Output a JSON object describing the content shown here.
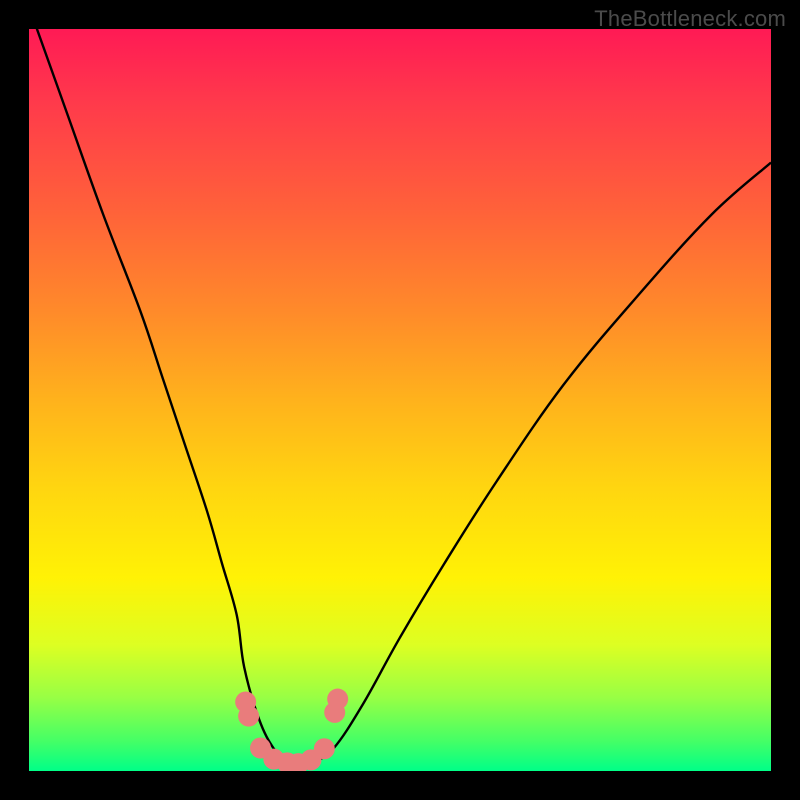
{
  "watermark": {
    "text": "TheBottleneck.com"
  },
  "chart_data": {
    "type": "line",
    "title": "",
    "xlabel": "",
    "ylabel": "",
    "xlim": [
      0,
      100
    ],
    "ylim": [
      0,
      100
    ],
    "series": [
      {
        "name": "bottleneck-curve",
        "x": [
          0,
          5,
          10,
          15,
          18,
          21,
          24,
          26,
          28,
          29,
          31,
          33,
          35,
          36.5,
          38,
          41,
          45,
          50,
          56,
          63,
          72,
          82,
          92,
          100
        ],
        "values": [
          103,
          89,
          75,
          62,
          53,
          44,
          35,
          28,
          21,
          14,
          7,
          3,
          1,
          0.5,
          1,
          3,
          9,
          18,
          28,
          39,
          52,
          64,
          75,
          82
        ]
      }
    ],
    "markers": {
      "name": "highlighted-points",
      "color": "#e97c7c",
      "points": [
        {
          "x": 29.2,
          "y": 9.3
        },
        {
          "x": 29.6,
          "y": 7.4
        },
        {
          "x": 31.2,
          "y": 3.1
        },
        {
          "x": 33.0,
          "y": 1.6
        },
        {
          "x": 34.8,
          "y": 1.1
        },
        {
          "x": 36.3,
          "y": 1.0
        },
        {
          "x": 38.0,
          "y": 1.5
        },
        {
          "x": 39.8,
          "y": 3.0
        },
        {
          "x": 41.2,
          "y": 7.9
        },
        {
          "x": 41.6,
          "y": 9.7
        }
      ]
    }
  }
}
